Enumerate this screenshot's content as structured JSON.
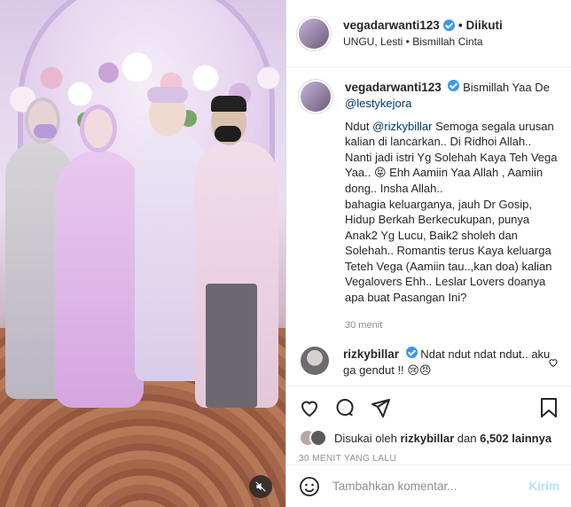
{
  "header": {
    "username": "vegadarwanti123",
    "follow_status": "Diikuti",
    "subline": "UNGU, Lesti • Bismillah Cinta"
  },
  "caption": {
    "username": "vegadarwanti123",
    "line1": "Bismillah Yaa De",
    "mention1": "@lestykejora",
    "mention2": "@rizkybillar",
    "text_after_mention2": " Semoga segala urusan kalian di lancarkan.. Di Ridhoi Allah..",
    "text_a_prefix": "Ndut ",
    "text_b": "Nanti jadi istri Yg Solehah Kaya Teh Vega Yaa.. 😝 Ehh Aamiin Yaa Allah , Aamiin dong.. Insha Allah..",
    "text_c": "bahagia keluarganya, jauh Dr Gosip, Hidup Berkah Berkecukupan, punya Anak2 Yg Lucu, Baik2 sholeh dan Solehah.. Romantis terus Kaya keluarga Teteh Vega (Aamiin tau..,kan doa) kalian Vegalovers Ehh.. Leslar Lovers doanya apa buat Pasangan Ini?",
    "time": "30 menit"
  },
  "reply": {
    "username": "rizkybillar",
    "text": "Ndat ndut ndat ndut.. aku ga gendut !! 😢😠"
  },
  "likes": {
    "prefix": "Disukai oleh",
    "user": "rizkybillar",
    "joiner": "dan",
    "count": "6,502 lainnya"
  },
  "post_time": "30 MENIT YANG LALU",
  "add_comment": {
    "placeholder": "Tambahkan komentar...",
    "post_label": "Kirim"
  },
  "colors": {
    "verified": "#3897f0",
    "mention": "#00376b",
    "post_button": "#b2dffc"
  },
  "icons": [
    "verified-badge-icon",
    "heart-icon",
    "comment-icon",
    "share-icon",
    "bookmark-icon",
    "emoji-icon",
    "mute-icon",
    "like-small-icon"
  ]
}
